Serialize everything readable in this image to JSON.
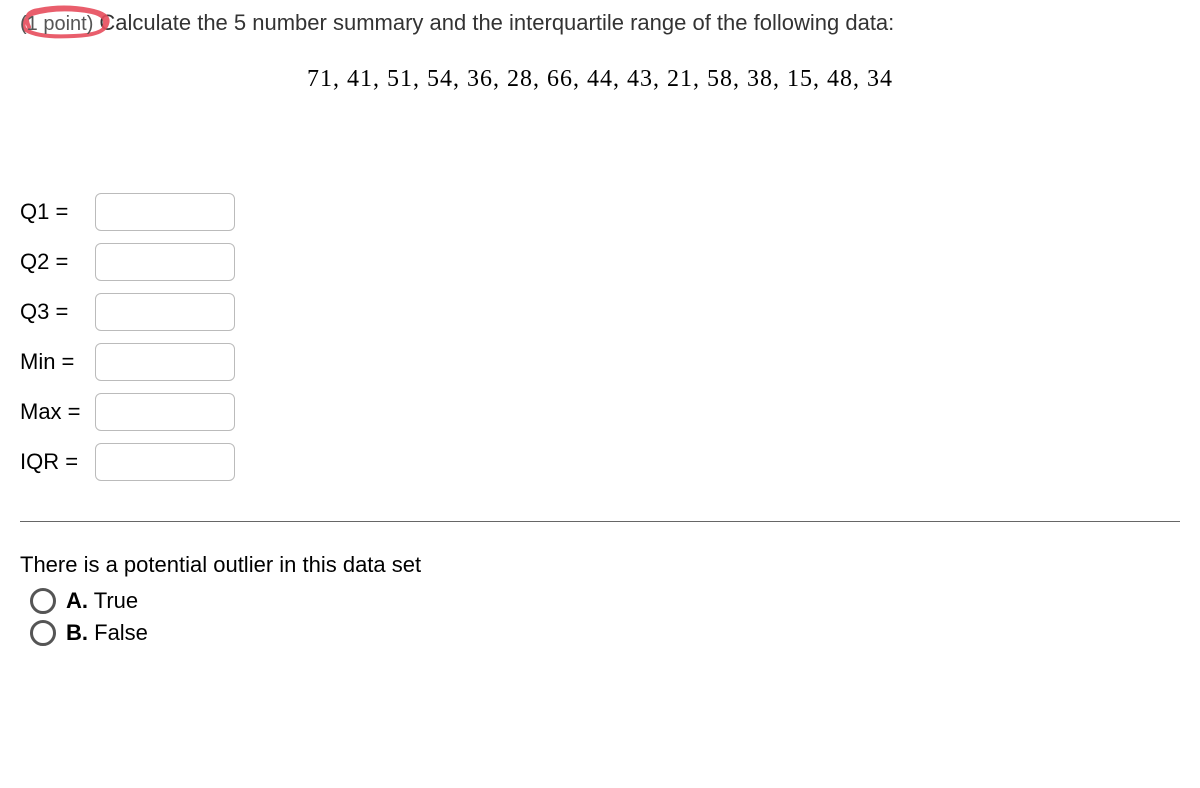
{
  "header": {
    "point_label": "(1 point)",
    "question": "Calculate the 5 number summary and the interquartile range of the following data:"
  },
  "data_values": "71,  41,  51,  54,  36,  28,  66,  44,  43,  21,  58,  38,  15,  48,  34",
  "inputs": [
    {
      "label": "Q1 =",
      "value": ""
    },
    {
      "label": "Q2 =",
      "value": ""
    },
    {
      "label": "Q3 =",
      "value": ""
    },
    {
      "label": "Min =",
      "value": ""
    },
    {
      "label": "Max =",
      "value": ""
    },
    {
      "label": "IQR =",
      "value": ""
    }
  ],
  "tf": {
    "prompt": "There is a potential outlier in this data set",
    "options": [
      {
        "letter": "A.",
        "text": "True"
      },
      {
        "letter": "B.",
        "text": "False"
      }
    ]
  }
}
